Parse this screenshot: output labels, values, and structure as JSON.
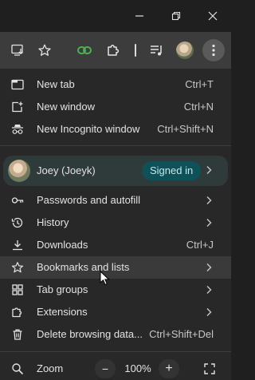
{
  "window_controls": {
    "minimize": "minimize",
    "restore": "restore",
    "close": "close"
  },
  "toolbar": {
    "install_icon": "install-app-icon",
    "bookmark_icon": "star-icon",
    "extension_icon": "extension-puzzle-icon",
    "media_icon": "media-queue-icon"
  },
  "menu": {
    "group1": [
      {
        "label": "New tab",
        "shortcut": "Ctrl+T"
      },
      {
        "label": "New window",
        "shortcut": "Ctrl+N"
      },
      {
        "label": "New Incognito window",
        "shortcut": "Ctrl+Shift+N"
      }
    ],
    "profile": {
      "name": "Joey (Joeyk)",
      "badge": "Signed in"
    },
    "group2": [
      {
        "label": "Passwords and autofill",
        "shortcut": ""
      },
      {
        "label": "History",
        "shortcut": ""
      },
      {
        "label": "Downloads",
        "shortcut": "Ctrl+J"
      },
      {
        "label": "Bookmarks and lists",
        "shortcut": ""
      },
      {
        "label": "Tab groups",
        "shortcut": ""
      },
      {
        "label": "Extensions",
        "shortcut": ""
      },
      {
        "label": "Delete browsing data...",
        "shortcut": "Ctrl+Shift+Del"
      }
    ],
    "zoom": {
      "label": "Zoom",
      "minus": "−",
      "value": "100%",
      "plus": "+"
    }
  },
  "colors": {
    "menu_bg": "#282828",
    "toolbar_bg": "#3c3c3c",
    "badge_bg": "#0f5158",
    "hover_bg": "#3a3a3a"
  }
}
